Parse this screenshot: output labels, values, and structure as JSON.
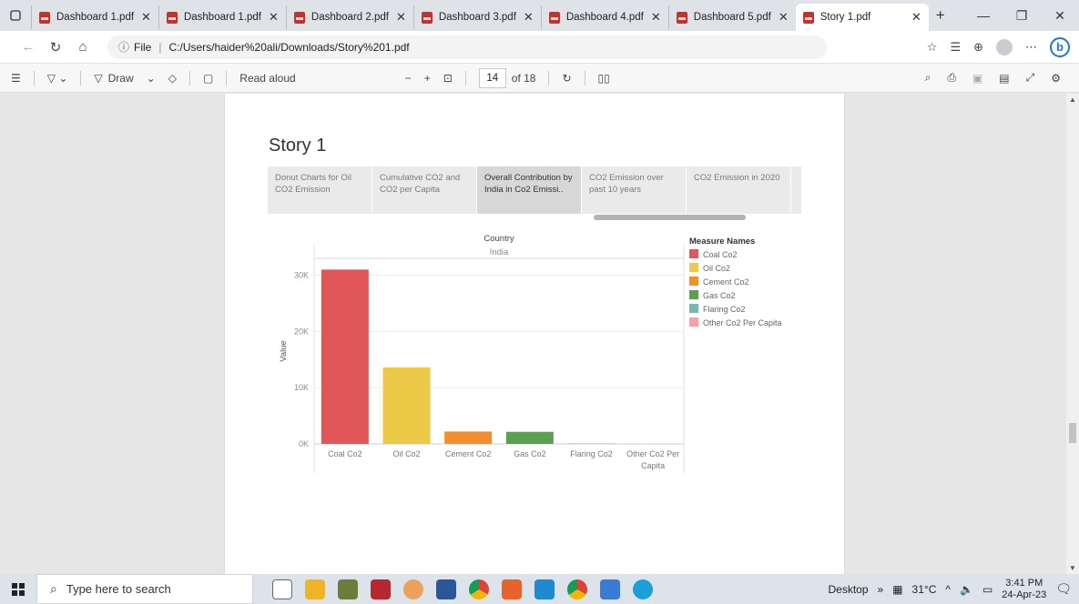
{
  "tabs": [
    {
      "label": "Dashboard 1.pdf",
      "active": false
    },
    {
      "label": "Dashboard 1.pdf",
      "active": false
    },
    {
      "label": "Dashboard 2.pdf",
      "active": false
    },
    {
      "label": "Dashboard 3.pdf",
      "active": false
    },
    {
      "label": "Dashboard 4.pdf",
      "active": false
    },
    {
      "label": "Dashboard 5.pdf",
      "active": false
    },
    {
      "label": "Story 1.pdf",
      "active": true
    }
  ],
  "address": {
    "scheme_label": "File",
    "url": "C:/Users/haider%20ali/Downloads/Story%201.pdf"
  },
  "pdf_toolbar": {
    "draw_label": "Draw",
    "read_aloud_label": "Read aloud",
    "current_page": "14",
    "page_total": "of 18"
  },
  "story": {
    "title": "Story 1",
    "points": [
      {
        "label": "Donut Charts for Oil CO2 Emission",
        "active": false
      },
      {
        "label": "Cumulative CO2 and CO2 per Capita",
        "active": false
      },
      {
        "label": "Overall Contribution by India in Co2 Emissi..",
        "active": true
      },
      {
        "label": "CO2 Emission over past 10 years",
        "active": false
      },
      {
        "label": "CO2 Emission in 2020",
        "active": false
      }
    ]
  },
  "chart_data": {
    "type": "bar",
    "column_header": "Country",
    "column_value": "India",
    "ylabel": "Value",
    "ylim": [
      0,
      33000
    ],
    "yticks": [
      {
        "v": 0,
        "label": "0K"
      },
      {
        "v": 10000,
        "label": "10K"
      },
      {
        "v": 20000,
        "label": "20K"
      },
      {
        "v": 30000,
        "label": "30K"
      }
    ],
    "grid": true,
    "legend_title": "Measure Names",
    "legend_position": "right",
    "categories": [
      "Coal Co2",
      "Oil Co2",
      "Cement Co2",
      "Gas Co2",
      "Flaring Co2",
      "Other Co2 Per Capita"
    ],
    "category_lines": [
      [
        "Coal Co2"
      ],
      [
        "Oil Co2"
      ],
      [
        "Cement Co2"
      ],
      [
        "Gas Co2"
      ],
      [
        "Flaring Co2"
      ],
      [
        "Other Co2 Per",
        "Capita"
      ]
    ],
    "values": [
      31000,
      13600,
      2200,
      2150,
      80,
      0
    ],
    "colors": [
      "#e15759",
      "#edc948",
      "#f28e2b",
      "#59a14f",
      "#76b7b2",
      "#ff9da7"
    ]
  },
  "taskbar": {
    "search_placeholder": "Type here to search",
    "desktop_label": "Desktop",
    "weather": "31°C",
    "time": "3:41 PM",
    "date": "24-Apr-23"
  },
  "colors": {
    "tabbar_bg": "#dfe3e8",
    "taskbar_bg": "#dde3ea",
    "accent": "#1a73e8"
  }
}
